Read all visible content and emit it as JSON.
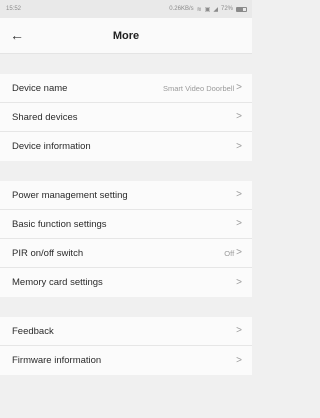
{
  "status_bar": {
    "time": "15:52",
    "net_speed": "0.26KB/s",
    "icons": [
      "wifi-icon",
      "sim-icon",
      "signal-icon"
    ],
    "battery": "72%",
    "battery_level": 0.72
  },
  "header": {
    "back_icon": "←",
    "title": "More"
  },
  "groups": [
    {
      "items": [
        {
          "label": "Device name",
          "value": "Smart Video Doorbell",
          "chevron": ">"
        },
        {
          "label": "Shared devices",
          "value": "",
          "chevron": ">"
        },
        {
          "label": "Device information",
          "value": "",
          "chevron": ">"
        }
      ]
    },
    {
      "items": [
        {
          "label": "Power management setting",
          "value": "",
          "chevron": ">"
        },
        {
          "label": "Basic function settings",
          "value": "",
          "chevron": ">"
        },
        {
          "label": "PIR on/off switch",
          "value": "Off",
          "chevron": ">"
        },
        {
          "label": "Memory card settings",
          "value": "",
          "chevron": ">"
        }
      ]
    },
    {
      "items": [
        {
          "label": "Feedback",
          "value": "",
          "chevron": ">"
        },
        {
          "label": "Firmware information",
          "value": "",
          "chevron": ">"
        }
      ]
    }
  ]
}
